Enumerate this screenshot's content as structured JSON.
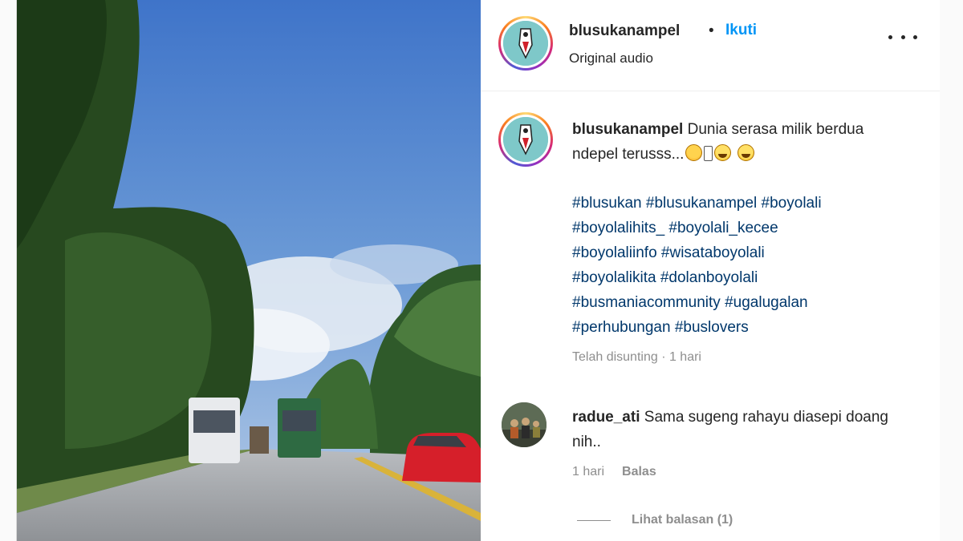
{
  "post": {
    "username": "blusukanampel",
    "separator": "•",
    "follow_label": "Ikuti",
    "audio_label": "Original audio",
    "more_icon": "more-options-icon"
  },
  "caption": {
    "username": "blusukanampel",
    "text": "Dunia serasa milik berdua ndepel terusss...",
    "emojis": [
      "hot-face-emoji",
      "missing-glyph",
      "laughing-emoji",
      "laughing-emoji"
    ],
    "hashtag_lines": [
      "#blusukan #blusukanampel #boyolali",
      "#boyolalihits_ #boyolali_kecee",
      "#boyolaliinfo #wisataboyolali",
      "#boyolalikita #dolanboyolali",
      "#busmaniacommunity #ugalugalan",
      "#perhubungan #buslovers"
    ],
    "edited_meta": "Telah disunting · 1 hari"
  },
  "comment": {
    "username": "radue_ati",
    "text": "Sama sugeng rahayu diasepi doang nih..",
    "time": "1 hari",
    "reply_label": "Balas",
    "view_replies_label": "Lihat balasan (1)"
  },
  "colors": {
    "link_blue": "#0095f6",
    "hashtag": "#00376b",
    "muted": "#8e8e8e",
    "text": "#262626"
  }
}
